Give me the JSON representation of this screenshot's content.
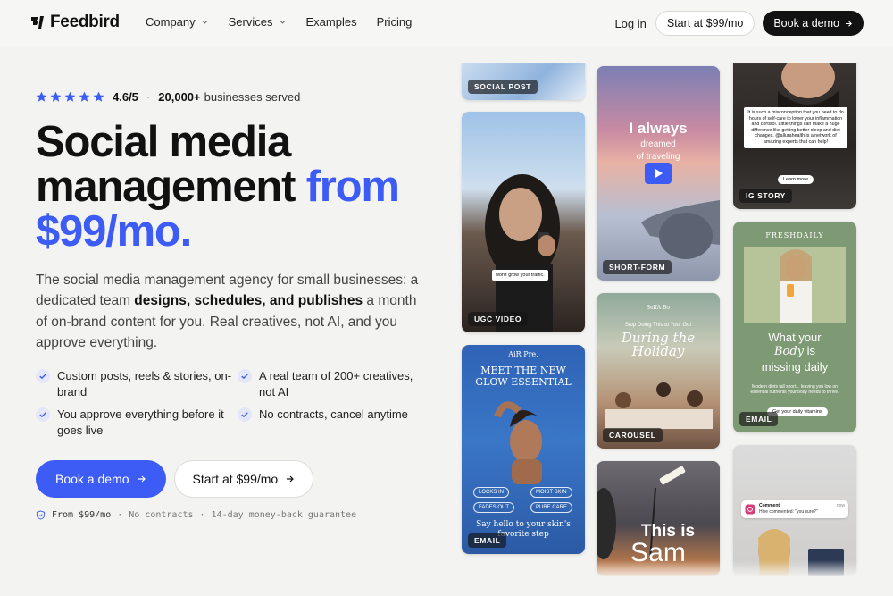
{
  "brand": {
    "name": "Feedbird",
    "accent": "#3d5bf5"
  },
  "nav": {
    "links": [
      {
        "label": "Company",
        "dropdown": true
      },
      {
        "label": "Services",
        "dropdown": true
      },
      {
        "label": "Examples",
        "dropdown": false
      },
      {
        "label": "Pricing",
        "dropdown": false
      }
    ],
    "login": "Log in",
    "start": "Start at $99/mo",
    "demo": "Book a demo"
  },
  "hero": {
    "rating": {
      "stars": 5,
      "value": "4.6/5",
      "count": "20,000+",
      "count_suffix": "businesses served"
    },
    "headline": {
      "line1": "Social media",
      "line2_dark": "management",
      "line2_blue": "from",
      "line3_blue": "$99/mo."
    },
    "subtext": {
      "pre": "The social media management agency for small businesses: a dedicated team ",
      "bold": "designs, schedules, and publishes",
      "post": " a month of on-brand content for you. Real creatives, not AI, and you approve everything."
    },
    "features": [
      "Custom posts, reels & stories, on-brand",
      "A real team of 200+ creatives, not AI",
      "You approve everything before it goes live",
      "No contracts, cancel anytime"
    ],
    "cta_primary": "Book a demo",
    "cta_secondary": "Start at $99/mo",
    "guarantee": {
      "from": "From $99/mo",
      "contracts": "No contracts",
      "refund": "14-day money-back guarantee",
      "sep": "·"
    }
  },
  "cards": [
    {
      "tag": "SOCIAL POST"
    },
    {
      "tag": "UGC VIDEO",
      "caption": "won't grow your traffic."
    },
    {
      "tag": "EMAIL",
      "brand": "AiR Pre.",
      "title": "MEET THE NEW GLOW ESSENTIAL",
      "pills": [
        "LOCKS IN",
        "MOIST SKIN",
        "FADES OUT",
        "PURE CARE"
      ],
      "footer": "Say hello to your skin's favorite step"
    },
    {
      "tag": "SHORT-FORM",
      "overlay1": "I always",
      "overlay2": "dreamed",
      "overlay3": "of traveling"
    },
    {
      "tag": "CAROUSEL",
      "brand": "SelfA Bo",
      "kicker": "Stop Doing This to Your Gut",
      "title1": "During the",
      "title2": "Holiday"
    },
    {
      "overlay1": "This is",
      "overlay2": "Sam"
    },
    {
      "tag": "IG STORY",
      "quote": "It is such a misconception that you need to do hours of self-care to lower your inflammation and cortisol. Little things can make a huge difference like getting better sleep and diet changes. @allurahealth is a network of amazing experts that can help!",
      "more": "Learn more"
    },
    {
      "tag": "EMAIL",
      "brand": "FRESHDAILY",
      "title1": "What your",
      "title2": "Body",
      "title3": "is",
      "title4": "missing daily",
      "body": "Modern diets fall short... leaving you low on essential nutrients your body needs to thrive.",
      "button": "Get your daily vitamins"
    },
    {
      "comment_title": "Comment",
      "comment_text": "Hive commented: \"you sure?\"",
      "comment_time": "now"
    }
  ]
}
